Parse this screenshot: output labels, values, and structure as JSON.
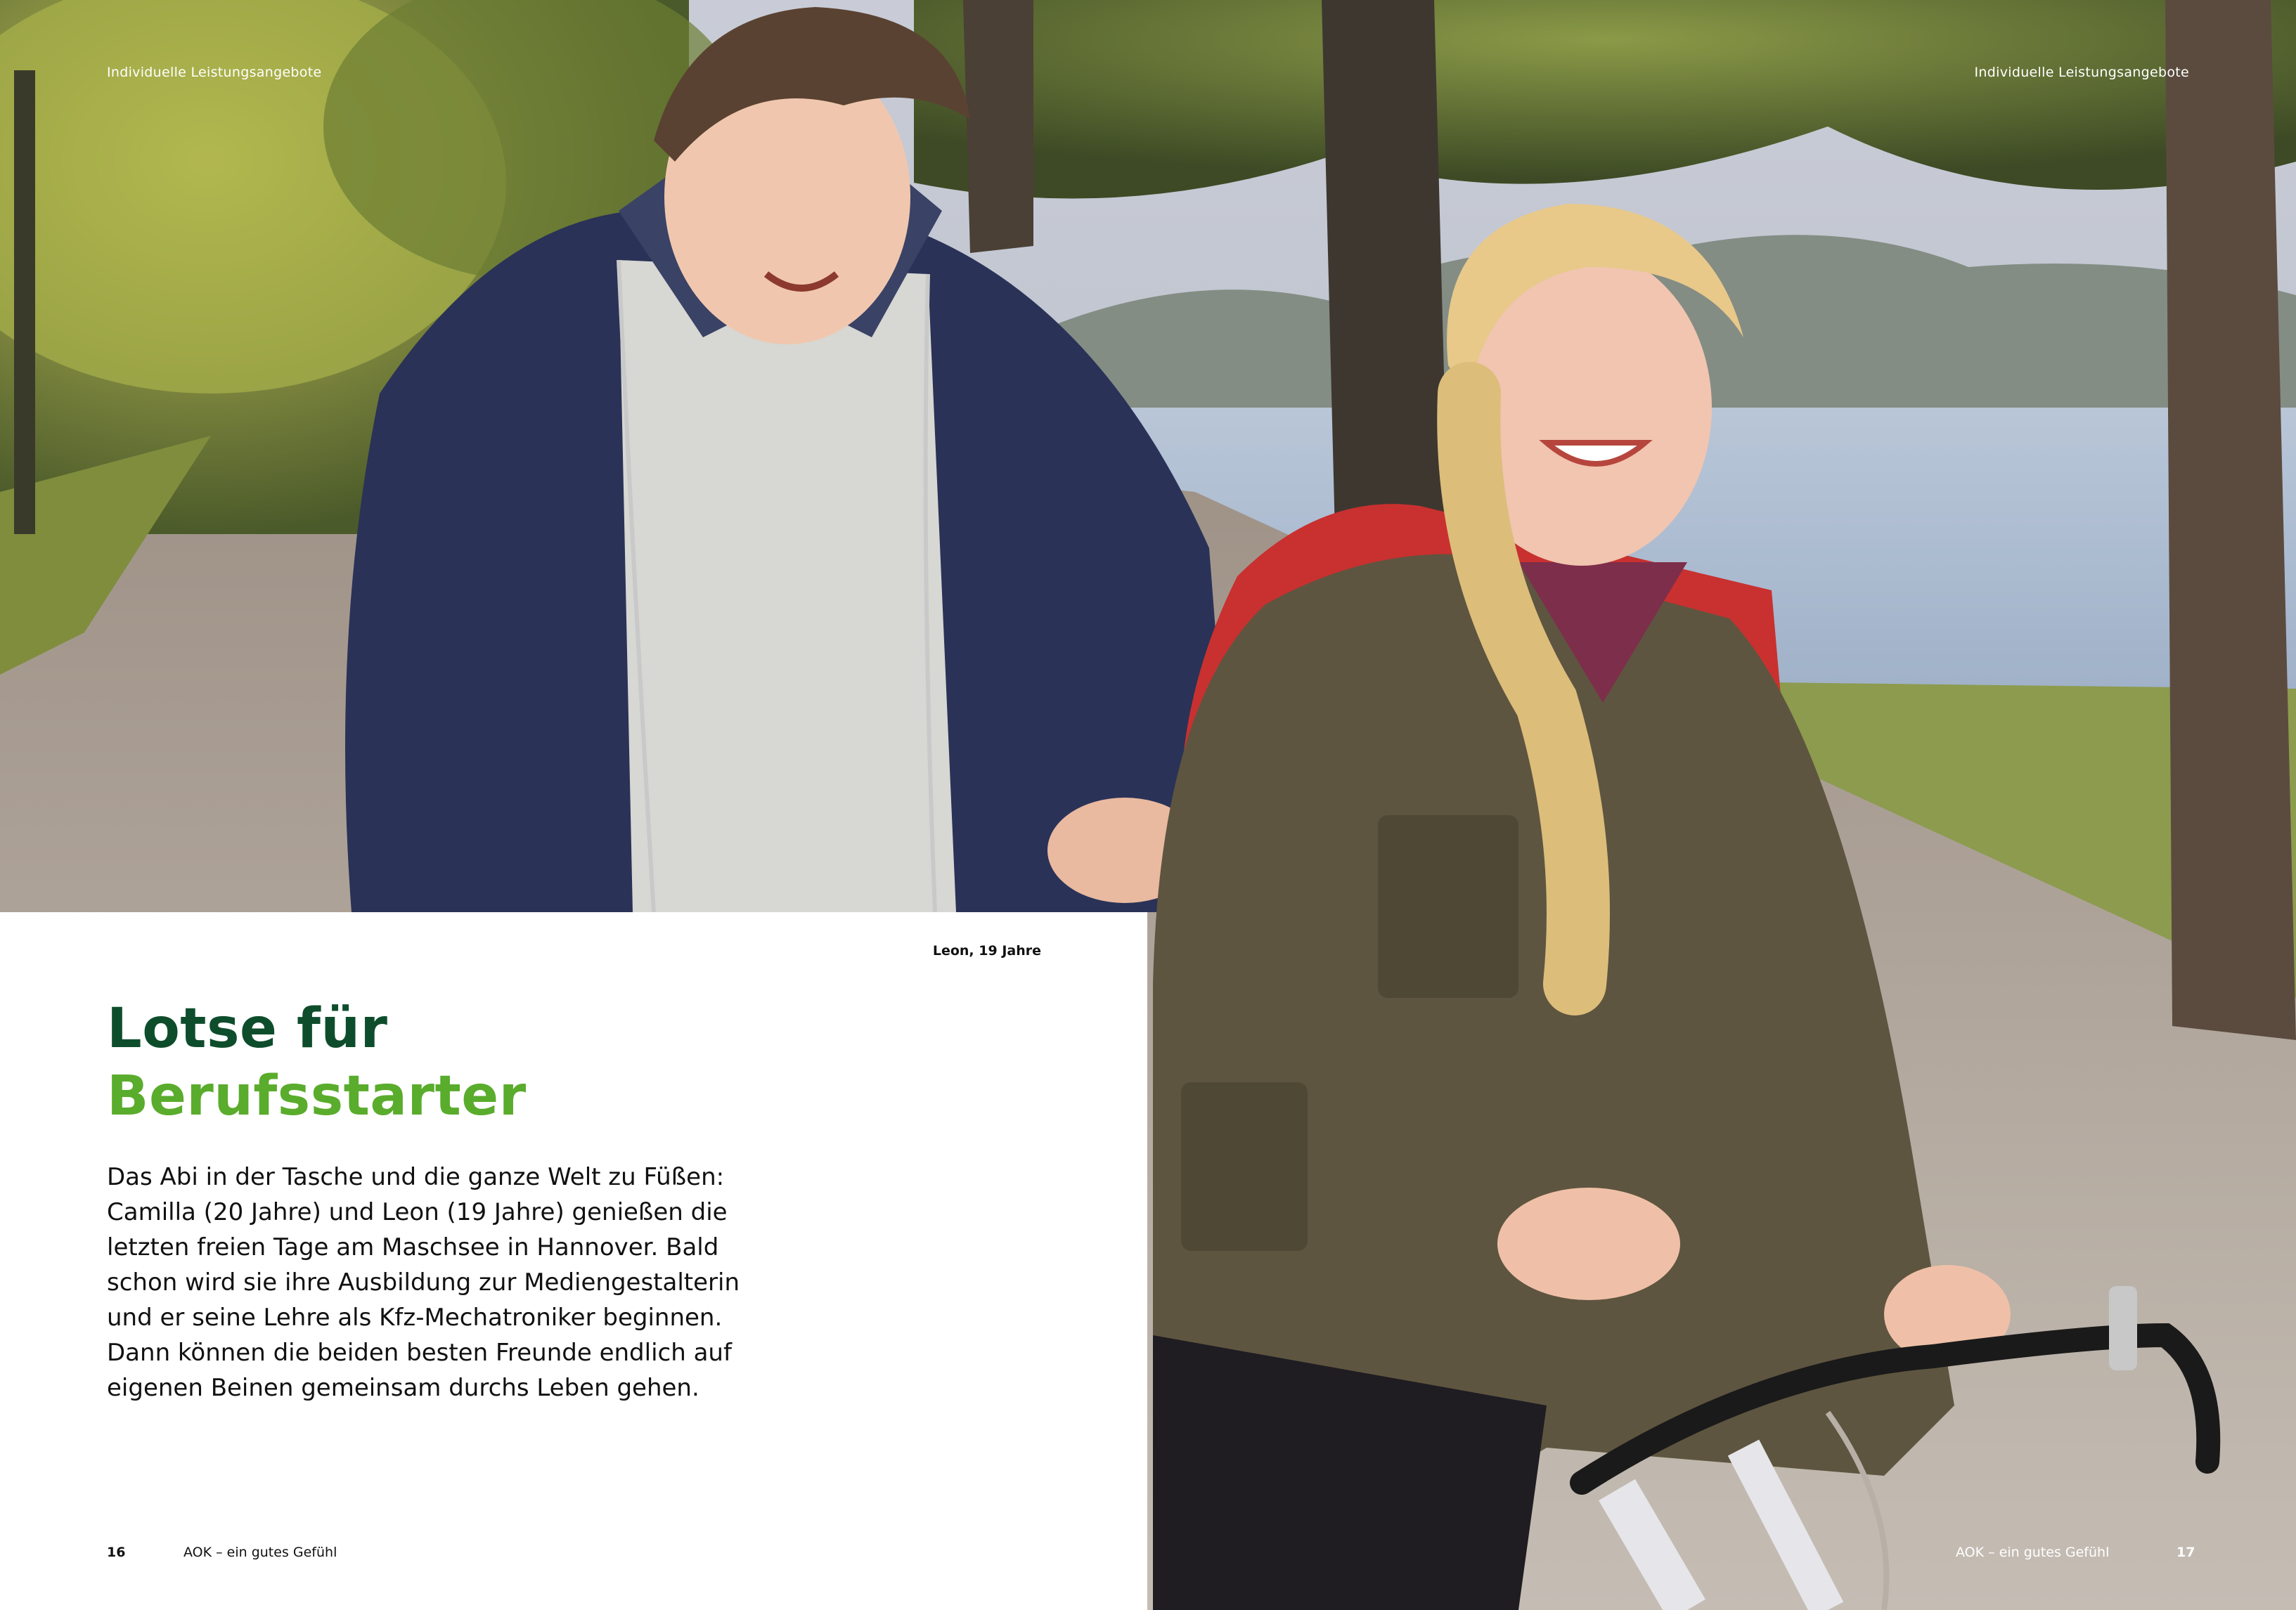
{
  "running_header": {
    "left": "Individuelle Leistungsangebote",
    "right": "Individuelle Leistungsangebote"
  },
  "photo_caption": "Leon, 19 Jahre",
  "headline": {
    "line1": "Lotse für",
    "line2": "Berufsstarter"
  },
  "body_lines": [
    "Das Abi in der Tasche und die ganze Welt zu Füßen:",
    "Camilla (20 Jahre) und Leon (19 Jahre) genießen die",
    "letzten freien Tage am Maschsee in Hannover. Bald",
    "schon wird sie ihre Ausbildung zur Mediengestalterin",
    "und er seine Lehre als Kfz-Mechatroniker beginnen.",
    "Dann können die beiden besten Freunde endlich auf",
    "eigenen Beinen gemeinsam durchs Leben gehen."
  ],
  "footer": {
    "left_page_number": "16",
    "left_title": "AOK – ein gutes Gefühl",
    "right_title": "AOK – ein gutes Gefühl",
    "right_page_number": "17"
  },
  "colors": {
    "headline_dark_green": "#0e4d2c",
    "headline_light_green": "#5aac2c"
  }
}
